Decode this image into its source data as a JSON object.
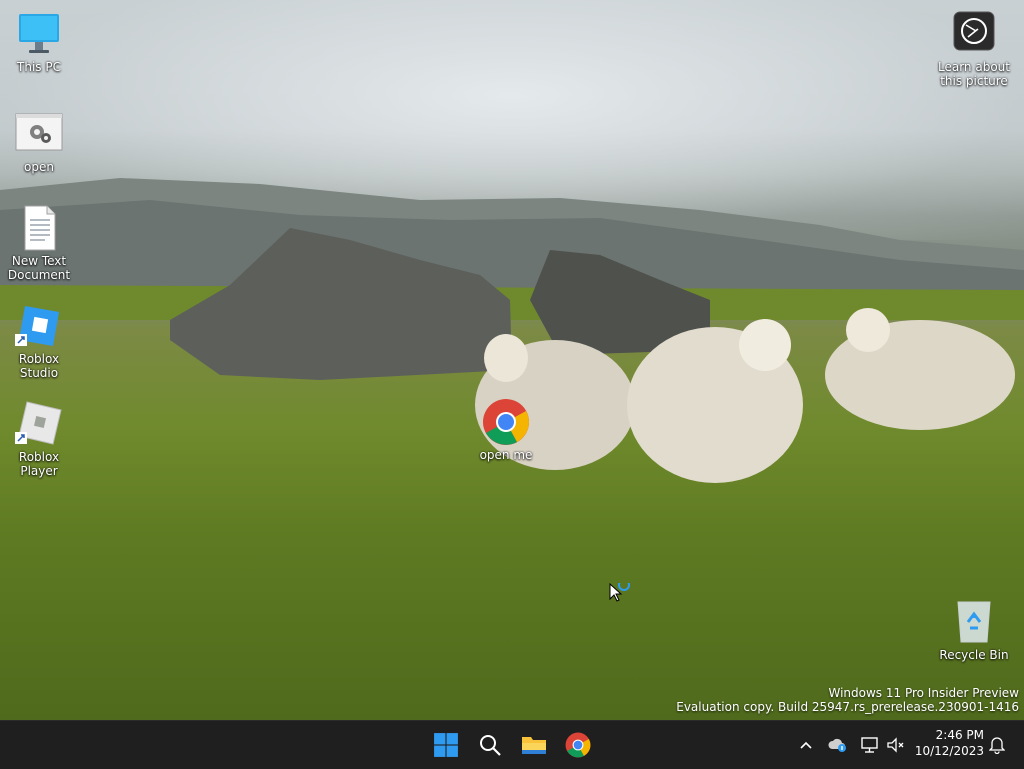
{
  "desktop": {
    "icons": {
      "this_pc": "This PC",
      "open": "open",
      "new_text_document": "New Text Document",
      "roblox_studio": "Roblox Studio",
      "roblox_player": "Roblox Player",
      "open_me": "open me",
      "learn_picture": "Learn about this picture",
      "recycle_bin": "Recycle Bin"
    },
    "watermark": {
      "line1": "Windows 11 Pro Insider Preview",
      "line2": "Evaluation copy. Build 25947.rs_prerelease.230901-1416"
    }
  },
  "taskbar": {
    "apps": [
      "start",
      "search",
      "file-explorer",
      "chrome"
    ],
    "clock": {
      "time": "2:46 PM",
      "date": "10/12/2023"
    }
  },
  "colors": {
    "taskbar": "#1f1f1f",
    "start_blue": "#2f9bf0"
  }
}
